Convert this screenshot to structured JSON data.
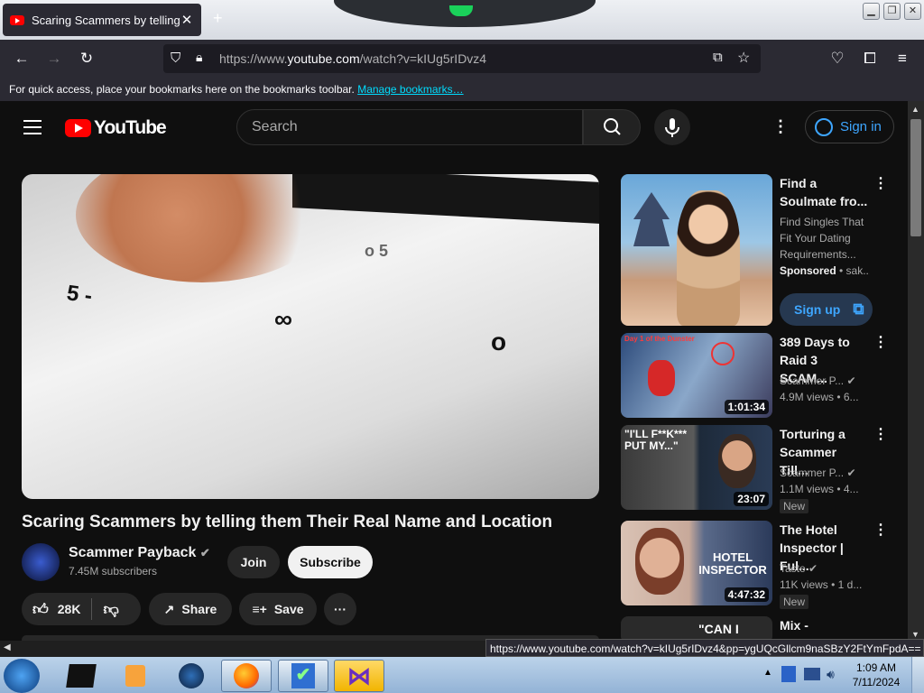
{
  "browser": {
    "tab_title": "Scaring Scammers by telling th",
    "new_tab": "+",
    "url_prefix": "https://www.",
    "url_domain": "youtube.com",
    "url_path": "/watch?v=kIUg5rIDvz4",
    "bookmarks_text": "For quick access, place your bookmarks here on the bookmarks toolbar.",
    "bookmarks_link": "Manage bookmarks…",
    "status_url": "https://www.youtube.com/watch?v=kIUg5rIDvz4&pp=ygUQcGllcm9naSBzY2FtYmFpdA=="
  },
  "youtube": {
    "logo_text": "YouTube",
    "search_placeholder": "Search",
    "signin_label": "Sign in",
    "video": {
      "title": "Scaring Scammers by telling them Their Real Name and Location",
      "channel": "Scammer Payback",
      "subscribers": "7.45M subscribers",
      "join_label": "Join",
      "subscribe_label": "Subscribe",
      "likes": "28K",
      "share_label": "Share",
      "save_label": "Save",
      "more_label": "···"
    },
    "sidebar": [
      {
        "title_l1": "Find a",
        "title_l2": "Soulmate fro...",
        "meta1": "Find Singles That",
        "meta2": "Fit Your Dating",
        "meta3": "Requirements...",
        "sponsor": "Sponsored",
        "sponsor_tail": " • sak...",
        "cta": "Sign up"
      },
      {
        "title_l1": "389 Days to",
        "title_l2": "Raid 3 SCAM...",
        "channel": "Scammer P...",
        "stats": "4.9M views • 6...",
        "duration": "1:01:34",
        "thumb_text": "Day 1 of the Dunster"
      },
      {
        "title_l1": "Torturing a",
        "title_l2": "Scammer Till...",
        "channel": "Scammer P...",
        "stats": "1.1M views • 4...",
        "duration": "23:07",
        "badge": "New",
        "thumb_text": "\"I'LL F**K*** PUT MY...\""
      },
      {
        "title_l1": "The Hotel",
        "title_l2": "Inspector | Ful...",
        "channel": "Taste",
        "stats": "11K views • 1 d...",
        "duration": "4:47:32",
        "badge": "New",
        "thumb_text": "HOTEL INSPECTOR"
      },
      {
        "title_l1": "Mix - Scammer",
        "thumb_text": "\"CAN I SPEAK"
      }
    ]
  },
  "taskbar": {
    "time": "1:09 AM",
    "date": "7/11/2024"
  }
}
